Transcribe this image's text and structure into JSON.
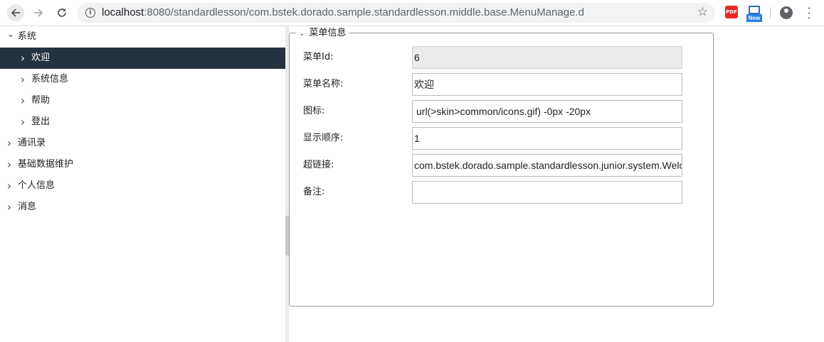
{
  "browser": {
    "url_host": "localhost",
    "url_rest": ":8080/standardlesson/com.bstek.dorado.sample.standardlesson.middle.base.MenuManage.d",
    "info_icon": "info-icon",
    "star_icon": "star-icon",
    "extensions": [
      {
        "name": "pdf-extension-icon",
        "text": "PDF"
      },
      {
        "name": "new-window-extension-icon",
        "text": "New"
      }
    ]
  },
  "tree": {
    "items": [
      {
        "label": "系统",
        "level": 0,
        "expanded": true,
        "selected": false
      },
      {
        "label": "欢迎",
        "level": 1,
        "expanded": false,
        "selected": true
      },
      {
        "label": "系统信息",
        "level": 1,
        "expanded": false,
        "selected": false
      },
      {
        "label": "帮助",
        "level": 1,
        "expanded": false,
        "selected": false
      },
      {
        "label": "登出",
        "level": 1,
        "expanded": false,
        "selected": false
      },
      {
        "label": "通讯录",
        "level": 0,
        "expanded": false,
        "selected": false
      },
      {
        "label": "基础数据维护",
        "level": 0,
        "expanded": false,
        "selected": false
      },
      {
        "label": "个人信息",
        "level": 0,
        "expanded": false,
        "selected": false
      },
      {
        "label": "消息",
        "level": 0,
        "expanded": false,
        "selected": false
      }
    ]
  },
  "form": {
    "legend": "菜单信息",
    "fields": [
      {
        "label": "菜单Id:",
        "value": "6",
        "readonly": true
      },
      {
        "label": "菜单名称:",
        "value": "欢迎",
        "readonly": false
      },
      {
        "label": "图标:",
        "value": "url(>skin>common/icons.gif) -0px -20px",
        "readonly": false
      },
      {
        "label": "显示顺序:",
        "value": "1",
        "readonly": false
      },
      {
        "label": "超链接:",
        "value": "com.bstek.dorado.sample.standardlesson.junior.system.Welcome.d",
        "readonly": false
      },
      {
        "label": "备注:",
        "value": "",
        "readonly": false
      }
    ]
  },
  "colors": {
    "selected_bg": "#253240",
    "selected_text": "#ffffff"
  }
}
